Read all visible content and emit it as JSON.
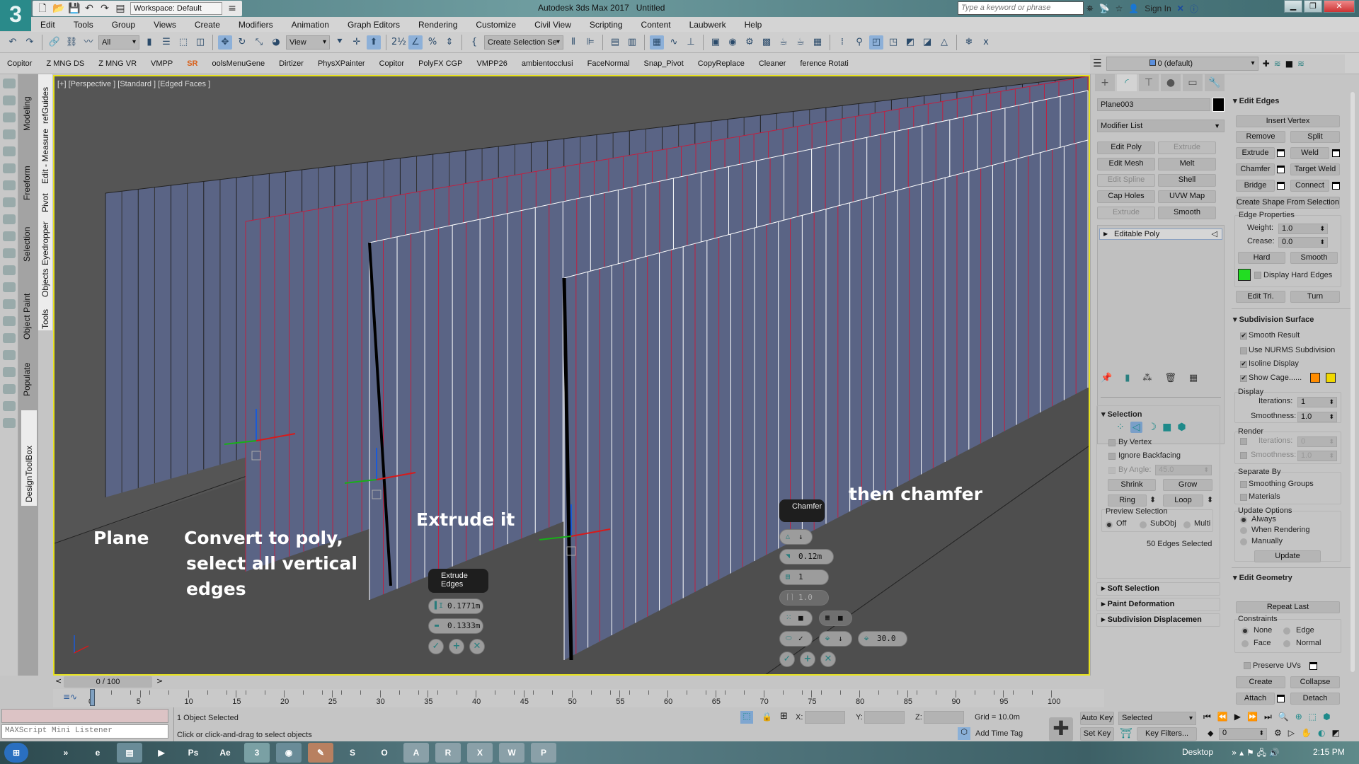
{
  "app": {
    "title": "Autodesk 3ds Max 2017",
    "document": "Untitled",
    "logo": "3",
    "workspace": "Workspace: Default",
    "search_placeholder": "Type a keyword or phrase",
    "sign_in": "Sign In"
  },
  "menu": [
    "Edit",
    "Tools",
    "Group",
    "Views",
    "Create",
    "Modifiers",
    "Animation",
    "Graph Editors",
    "Rendering",
    "Customize",
    "Civil View",
    "Scripting",
    "Content",
    "Laubwerk",
    "Help"
  ],
  "toolbar": {
    "selection_filter": "All",
    "ref_coord": "View",
    "named_selection": "Create Selection Se"
  },
  "plugin_toolbar": [
    "Copitor",
    "Z MNG DS",
    "Z MNG VR",
    "VMPP",
    "SR",
    "oolsMenuGene",
    "Dirtizer",
    "PhysXPainter",
    "Copitor",
    "PolyFX CGP",
    "VMPP26",
    "ambientocclusi",
    "FaceNormal",
    "Snap_Pivot",
    "CopyReplace",
    "Cleaner",
    "ference Rotati"
  ],
  "layer": {
    "current": "0 (default)"
  },
  "left_tabs": {
    "ribbon": [
      "Modeling",
      "Freeform",
      "Selection",
      "Object Paint",
      "Populate"
    ],
    "secondary": [
      "refGuides",
      "Edit - Measure",
      "Pivot",
      "Eyedropper",
      "Objects",
      "Tools"
    ],
    "design_toolbox": "DesignToolBox"
  },
  "viewport": {
    "label": "[+] [Perspective ] [Standard ] [Edged Faces ]",
    "annotations": {
      "plane": "Plane",
      "convert_1": "Convert to poly,",
      "convert_2": "select all vertical",
      "convert_3": "edges",
      "extrude": "Extrude it",
      "chamfer": "then chamfer"
    },
    "extrude_caddy": {
      "title": "Extrude Edges",
      "height": "0.1771m",
      "width": "0.1333m"
    },
    "chamfer_caddy": {
      "title": "Chamfer",
      "amount": "0.12m",
      "segments": "1",
      "tension": "1.0",
      "angle": "30.0"
    }
  },
  "command_panel": {
    "object_name": "Plane003",
    "modifier_list": "Modifier List",
    "modifier_buttons": [
      {
        "label": "Edit Poly",
        "enabled": true
      },
      {
        "label": "Extrude",
        "enabled": false
      },
      {
        "label": "Edit Mesh",
        "enabled": true
      },
      {
        "label": "Melt",
        "enabled": true
      },
      {
        "label": "Edit Spline",
        "enabled": false
      },
      {
        "label": "Shell",
        "enabled": true
      },
      {
        "label": "Cap Holes",
        "enabled": true
      },
      {
        "label": "UVW Map",
        "enabled": true
      },
      {
        "label": "Extrude",
        "enabled": false
      },
      {
        "label": "Smooth",
        "enabled": true
      }
    ],
    "stack": [
      "Editable Poly"
    ],
    "selection": {
      "title": "Selection",
      "by_vertex": "By Vertex",
      "ignore_backfacing": "Ignore Backfacing",
      "by_angle": "By Angle:",
      "by_angle_value": "45.0",
      "shrink": "Shrink",
      "grow": "Grow",
      "ring": "Ring",
      "loop": "Loop",
      "preview_selection": "Preview Selection",
      "preview_options": [
        "Off",
        "SubObj",
        "Multi"
      ],
      "preview_selected": "Off",
      "status": "50 Edges Selected"
    },
    "collapsed_rollouts": [
      "Soft Selection",
      "Paint Deformation",
      "Subdivision Displacemen"
    ]
  },
  "edit_edges": {
    "title": "Edit Edges",
    "insert_vertex": "Insert Vertex",
    "remove": "Remove",
    "split": "Split",
    "extrude": "Extrude",
    "weld": "Weld",
    "chamfer": "Chamfer",
    "target_weld": "Target Weld",
    "bridge": "Bridge",
    "connect": "Connect",
    "create_shape": "Create Shape From Selection",
    "edge_properties": "Edge Properties",
    "weight_label": "Weight:",
    "weight": "1.0",
    "crease_label": "Crease:",
    "crease": "0.0",
    "hard": "Hard",
    "smooth": "Smooth",
    "display_hard_edges": "Display Hard Edges",
    "hard_edge_color": "#22dd22",
    "edit_tri": "Edit Tri.",
    "turn": "Turn"
  },
  "subdivision": {
    "title": "Subdivision Surface",
    "smooth_result": "Smooth Result",
    "use_nurms": "Use NURMS Subdivision",
    "isoline": "Isoline Display",
    "show_cage": "Show Cage......",
    "cage_colors": [
      "#ff8c00",
      "#f0d800"
    ],
    "display": "Display",
    "iterations_label": "Iterations:",
    "display_iterations": "1",
    "smoothness_label": "Smoothness:",
    "display_smoothness": "1.0",
    "render": "Render",
    "render_iterations": "0",
    "render_smoothness": "1.0",
    "separate_by": "Separate By",
    "smoothing_groups": "Smoothing Groups",
    "materials": "Materials",
    "update_options": "Update Options",
    "update_choices": [
      "Always",
      "When Rendering",
      "Manually"
    ],
    "update_selected": "Always",
    "update": "Update"
  },
  "edit_geometry": {
    "title": "Edit Geometry",
    "repeat_last": "Repeat Last",
    "constraints": "Constraints",
    "constraint_options": [
      "None",
      "Edge",
      "Face",
      "Normal"
    ],
    "constraint_selected": "None",
    "preserve_uvs": "Preserve UVs",
    "create": "Create",
    "collapse": "Collapse",
    "attach": "Attach",
    "detach": "Detach"
  },
  "timeline": {
    "frame": "0 / 100",
    "ticks": [
      0,
      5,
      10,
      15,
      20,
      25,
      30,
      35,
      40,
      45,
      50,
      55,
      60,
      65,
      70,
      75,
      80,
      85,
      90,
      95,
      100
    ]
  },
  "status_bar": {
    "maxscript": "MAXScript Mini Listener",
    "selection": "1 Object Selected",
    "prompt": "Click or click-and-drag to select objects",
    "x_label": "X:",
    "y_label": "Y:",
    "z_label": "Z:",
    "grid": "Grid = 10.0m",
    "add_time_tag": "Add Time Tag",
    "auto_key": "Auto Key",
    "set_key": "Set Key",
    "key_mode": "Selected",
    "key_filters": "Key Filters...",
    "current_frame": "0"
  },
  "taskbar": {
    "apps": [
      "Start",
      "More",
      "Internet Explorer",
      "File Explorer",
      "Media",
      "Ps",
      "Ae",
      "3ds Max",
      "Chrome",
      "Paint",
      "Sketch",
      "Outlook",
      "Acrobat",
      "Revit",
      "Excel",
      "Word",
      "PowerPoint"
    ],
    "desktop": "Desktop",
    "clock": "2:15 PM"
  }
}
